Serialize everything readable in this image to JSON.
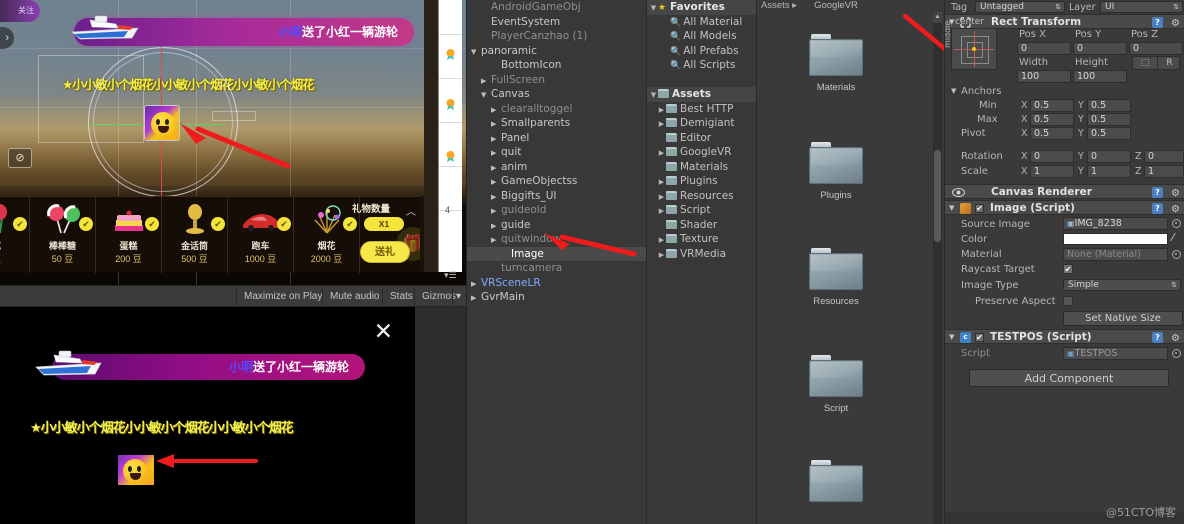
{
  "scene": {
    "follow_badge": "关注",
    "gift_banner": {
      "sender": "小明",
      "rest": "送了小红一辆游轮"
    },
    "marquee": "★小小敏小个烟花小小敏小个烟花小小敏小个烟花",
    "gifts": [
      {
        "name": "花",
        "price": "豆",
        "icon": "flower-icon"
      },
      {
        "name": "棒棒糖",
        "price": "50 豆",
        "icon": "lollipop-icon"
      },
      {
        "name": "蛋糕",
        "price": "200 豆",
        "icon": "cake-icon"
      },
      {
        "name": "金话筒",
        "price": "500 豆",
        "icon": "microphone-icon"
      },
      {
        "name": "跑车",
        "price": "1000 豆",
        "icon": "sportscar-icon"
      },
      {
        "name": "烟花",
        "price": "2000 豆",
        "icon": "fireworks-icon"
      }
    ],
    "gift_count_label": "礼物数量",
    "quantity_pill": "X1",
    "send_button": "送礼"
  },
  "game_toolbar": {
    "buttons": [
      "Maximize on Play",
      "Mute audio",
      "Stats",
      "Gizmos"
    ]
  },
  "preview": {
    "close_label": "✕",
    "banner": {
      "sender": "小明",
      "rest": "送了小红一辆游轮"
    },
    "marquee": "★小小敏小个烟花小小敏小个烟花小小敏小个烟花"
  },
  "hierarchy": {
    "items": [
      {
        "label": "AndroidGameObj",
        "indent": 1,
        "tri": "none",
        "style": "dim"
      },
      {
        "label": "EventSystem",
        "indent": 1,
        "tri": "none",
        "style": "normal"
      },
      {
        "label": "PlayerCanzhao (1)",
        "indent": 1,
        "tri": "none",
        "style": "dim"
      },
      {
        "label": "panoramic",
        "indent": 0,
        "tri": "down",
        "style": "normal"
      },
      {
        "label": "BottomIcon",
        "indent": 2,
        "tri": "none",
        "style": "normal"
      },
      {
        "label": "FullScreen",
        "indent": 1,
        "tri": "right",
        "style": "dim"
      },
      {
        "label": "Canvas",
        "indent": 1,
        "tri": "down",
        "style": "normal"
      },
      {
        "label": "clearalltoggel",
        "indent": 2,
        "tri": "right",
        "style": "dim"
      },
      {
        "label": "Smallparents",
        "indent": 2,
        "tri": "right",
        "style": "normal"
      },
      {
        "label": "Panel",
        "indent": 2,
        "tri": "right",
        "style": "normal"
      },
      {
        "label": "quit",
        "indent": 2,
        "tri": "right",
        "style": "normal"
      },
      {
        "label": "anim",
        "indent": 2,
        "tri": "right",
        "style": "normal"
      },
      {
        "label": "GameObjectss",
        "indent": 2,
        "tri": "right",
        "style": "normal"
      },
      {
        "label": "Biggifts_UI",
        "indent": 2,
        "tri": "right",
        "style": "normal"
      },
      {
        "label": "guideold",
        "indent": 2,
        "tri": "right",
        "style": "dim"
      },
      {
        "label": "guide",
        "indent": 2,
        "tri": "right",
        "style": "normal"
      },
      {
        "label": "quitwindow",
        "indent": 2,
        "tri": "right",
        "style": "dim"
      },
      {
        "label": "Image",
        "indent": 3,
        "tri": "none",
        "style": "selected"
      },
      {
        "label": "turncamera",
        "indent": 2,
        "tri": "none",
        "style": "dim"
      },
      {
        "label": "VRSceneLR",
        "indent": 0,
        "tri": "right",
        "style": "blue"
      },
      {
        "label": "GvrMain",
        "indent": 0,
        "tri": "right",
        "style": "normal"
      }
    ]
  },
  "project_tree": {
    "favorites_label": "Favorites",
    "favorites": [
      {
        "label": "All Material",
        "icon": "search-icon"
      },
      {
        "label": "All Models",
        "icon": "search-icon"
      },
      {
        "label": "All Prefabs",
        "icon": "search-icon"
      },
      {
        "label": "All Scripts",
        "icon": "search-icon"
      }
    ],
    "assets_label": "Assets",
    "assets": [
      {
        "label": "Best HTTP",
        "tri": "right"
      },
      {
        "label": "Demigiant",
        "tri": "right"
      },
      {
        "label": "Editor",
        "tri": "none"
      },
      {
        "label": "GoogleVR",
        "tri": "right"
      },
      {
        "label": "Materials",
        "tri": "none"
      },
      {
        "label": "Plugins",
        "tri": "right"
      },
      {
        "label": "Resources",
        "tri": "right"
      },
      {
        "label": "Script",
        "tri": "right"
      },
      {
        "label": "Shader",
        "tri": "none"
      },
      {
        "label": "Texture",
        "tri": "right"
      },
      {
        "label": "VRMedia",
        "tri": "right"
      }
    ]
  },
  "project_grid": {
    "breadcrumb": "Assets ▸",
    "top_partial_label": "GoogleVR",
    "items": [
      {
        "label": "Materials"
      },
      {
        "label": "Plugins"
      },
      {
        "label": "Resources"
      },
      {
        "label": "Script"
      },
      {
        "label": ""
      }
    ]
  },
  "inspector": {
    "tag_label": "Tag",
    "tag_value": "Untagged",
    "layer_label": "Layer",
    "layer_value": "UI",
    "rect_transform": {
      "title": "Rect Transform",
      "anchor_preset": "center",
      "anchor_preset_side": "middle",
      "pos_x_label": "Pos X",
      "pos_x": "0",
      "pos_y_label": "Pos Y",
      "pos_y": "0",
      "pos_z_label": "Pos Z",
      "pos_z": "0",
      "width_label": "Width",
      "width": "100",
      "height_label": "Height",
      "height": "100",
      "blueprint_label": "R",
      "anchors_label": "Anchors",
      "min_label": "Min",
      "min_x": "0.5",
      "min_y": "0.5",
      "max_label": "Max",
      "max_x": "0.5",
      "max_y": "0.5",
      "pivot_label": "Pivot",
      "pivot_x": "0.5",
      "pivot_y": "0.5",
      "rotation_label": "Rotation",
      "rot_x": "0",
      "rot_y": "0",
      "rot_z": "0",
      "scale_label": "Scale",
      "scale_x": "1",
      "scale_y": "1",
      "scale_z": "1",
      "ax_x": "X",
      "ax_y": "Y",
      "ax_z": "Z"
    },
    "canvas_renderer": {
      "title": "Canvas Renderer"
    },
    "image_component": {
      "title": "Image (Script)",
      "source_image_label": "Source Image",
      "source_image_value": "IMG_8238",
      "color_label": "Color",
      "color_value": "#FFFFFF",
      "material_label": "Material",
      "material_value": "None (Material)",
      "raycast_label": "Raycast Target",
      "image_type_label": "Image Type",
      "image_type_value": "Simple",
      "preserve_aspect_label": "Preserve Aspect",
      "set_native_size_label": "Set Native Size"
    },
    "testpos_component": {
      "title": "TESTPOS (Script)",
      "script_label": "Script",
      "script_value": "TESTPOS"
    },
    "add_component_label": "Add Component"
  },
  "watermark": "@51CTO博客"
}
